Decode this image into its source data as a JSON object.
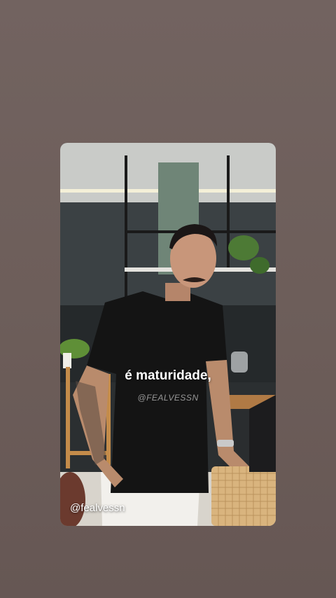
{
  "story": {
    "caption": "é maturidade,",
    "watermark": "@FEALVESSN",
    "handle": "@fealvessn"
  },
  "colors": {
    "background": "#6e5f5b",
    "caption_text": "#ffffff"
  }
}
